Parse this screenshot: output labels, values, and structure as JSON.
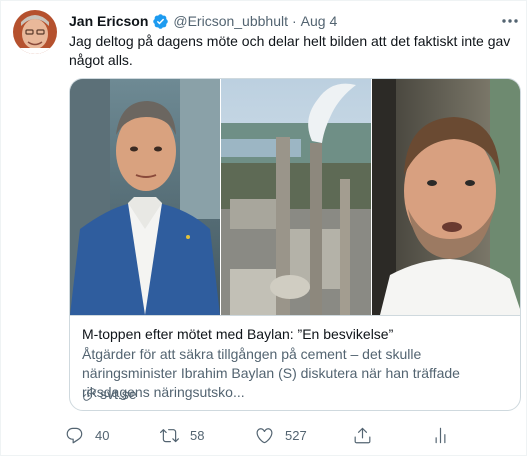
{
  "author": {
    "name": "Jan Ericson",
    "handle": "@Ericson_ubbhult",
    "separator": "·",
    "date": "Aug 4",
    "verified_color": "#1d9bf0",
    "avatar_icon": "profile-photo"
  },
  "tweet": {
    "text": "Jag deltog på dagens möte och delar helt bilden att det faktiskt inte gav något alls."
  },
  "card": {
    "title": "M-toppen efter mötet med Baylan: ”En besvikelse”",
    "description": "Åtgärder för att säkra tillgången på cement – det skulle näringsminister Ibrahim Baylan (S) diskutera när han träffade riksdagens näringsutsko...",
    "domain": "svt.se",
    "image_icons": [
      "man-in-blue-suit-photo",
      "cement-factory-chimney-photo",
      "bearded-man-photo"
    ]
  },
  "actions": {
    "replies": "40",
    "retweets": "58",
    "likes": "527",
    "reply_icon": "reply-icon",
    "retweet_icon": "retweet-icon",
    "like_icon": "heart-icon",
    "share_icon": "share-icon",
    "analytics_icon": "analytics-icon"
  },
  "colors": {
    "text_primary": "#0f1419",
    "text_secondary": "#536471",
    "border": "#cfd9de",
    "accent": "#1d9bf0"
  }
}
